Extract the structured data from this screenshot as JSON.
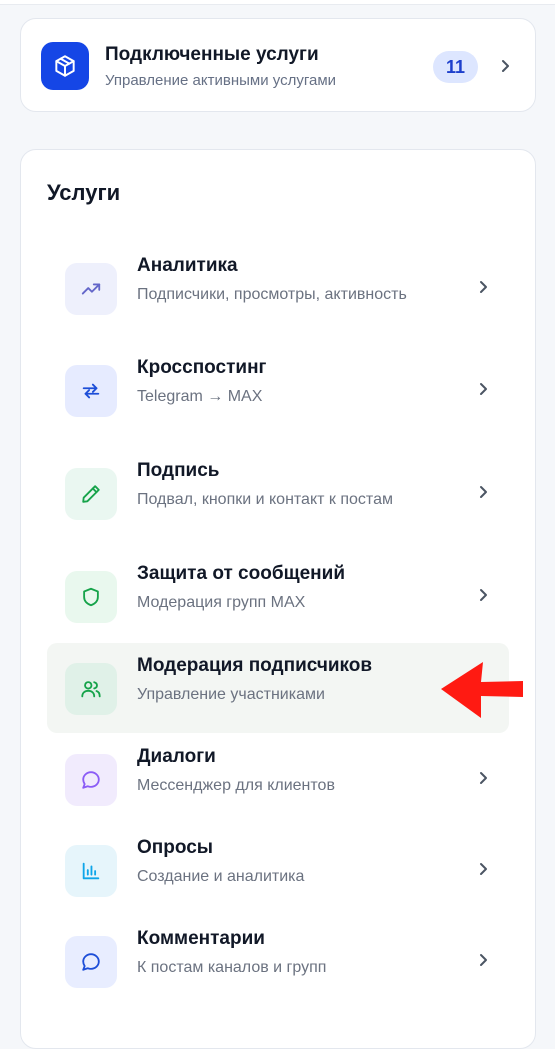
{
  "connected": {
    "title": "Подключенные услуги",
    "subtitle": "Управление активными услугами",
    "count": "11",
    "icon": "box-icon",
    "accent": "#1546e6"
  },
  "services": {
    "title": "Услуги",
    "items": [
      {
        "title": "Аналитика",
        "desc": "Подписчики, просмотры, активность",
        "icon": "trend-up-icon",
        "icon_bg": "#eef0fc",
        "icon_color": "#6366c9"
      },
      {
        "title": "Кросспостинг",
        "desc": "Telegram → MAX",
        "icon": "repost-icon",
        "icon_bg": "#e6ebff",
        "icon_color": "#1d4ed8"
      },
      {
        "title": "Подпись",
        "desc": "Подвал, кнопки и контакт к постам",
        "icon": "pencil-icon",
        "icon_bg": "#eaf7f1",
        "icon_color": "#16a34a"
      },
      {
        "title": "Защита от сообщений",
        "desc": "Модерация групп MAX",
        "icon": "shield-icon",
        "icon_bg": "#e9f8ee",
        "icon_color": "#16a34a"
      },
      {
        "title": "Модерация подписчиков",
        "desc": "Управление участниками",
        "icon": "users-icon",
        "icon_bg": "#e0f1e8",
        "icon_color": "#16a34a"
      },
      {
        "title": "Диалоги",
        "desc": "Мессенджер для клиентов",
        "icon": "chat-icon",
        "icon_bg": "#f1ebfd",
        "icon_color": "#8b5cf6"
      },
      {
        "title": "Опросы",
        "desc": "Создание и аналитика",
        "icon": "bar-chart-icon",
        "icon_bg": "#e6f5fb",
        "icon_color": "#0ea5e9"
      },
      {
        "title": "Комментарии",
        "desc": "К постам каналов и групп",
        "icon": "comment-icon",
        "icon_bg": "#e8edff",
        "icon_color": "#1d4ed8"
      }
    ]
  },
  "annotation": {
    "arrow_color": "#ff1a12"
  }
}
